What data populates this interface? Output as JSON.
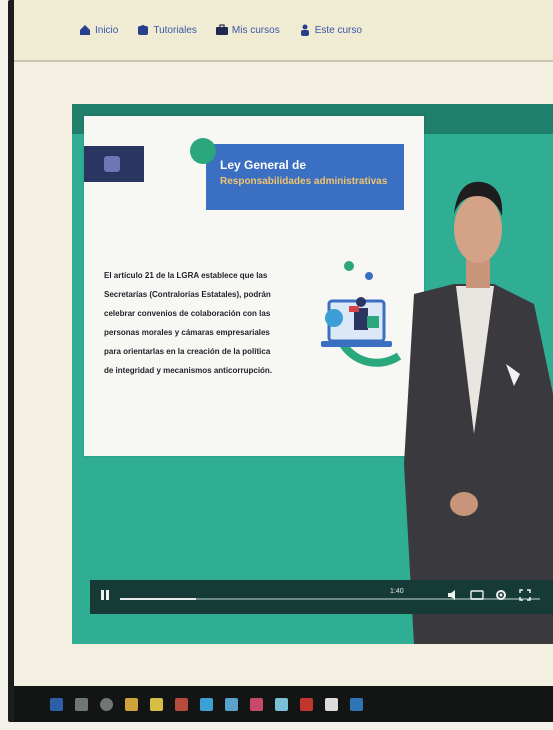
{
  "nav": {
    "items": [
      {
        "label": "Inicio",
        "icon": "home-icon"
      },
      {
        "label": "Tutoriales",
        "icon": "tutorial-icon"
      },
      {
        "label": "Mis cursos",
        "icon": "briefcase-icon"
      },
      {
        "label": "Este curso",
        "icon": "users-icon"
      }
    ]
  },
  "slide": {
    "title": "Ley General de",
    "subtitle": "Responsabilidades administrativas",
    "body_lines": [
      "El artículo 21 de la LGRA establece que las",
      "Secretarías (Contralorías Estatales), podrán",
      "celebrar convenios de colaboración con las",
      "personas morales y cámaras empresariales",
      "para orientarlas en la creación de la política",
      "de integridad y mecanismos anticorrupción."
    ]
  },
  "player": {
    "progress": 0.18,
    "time": "1:40"
  },
  "colors": {
    "video_teal": "#2fae93",
    "slide_header": "#3b6fc2",
    "nav_link": "#2a4aa0"
  }
}
